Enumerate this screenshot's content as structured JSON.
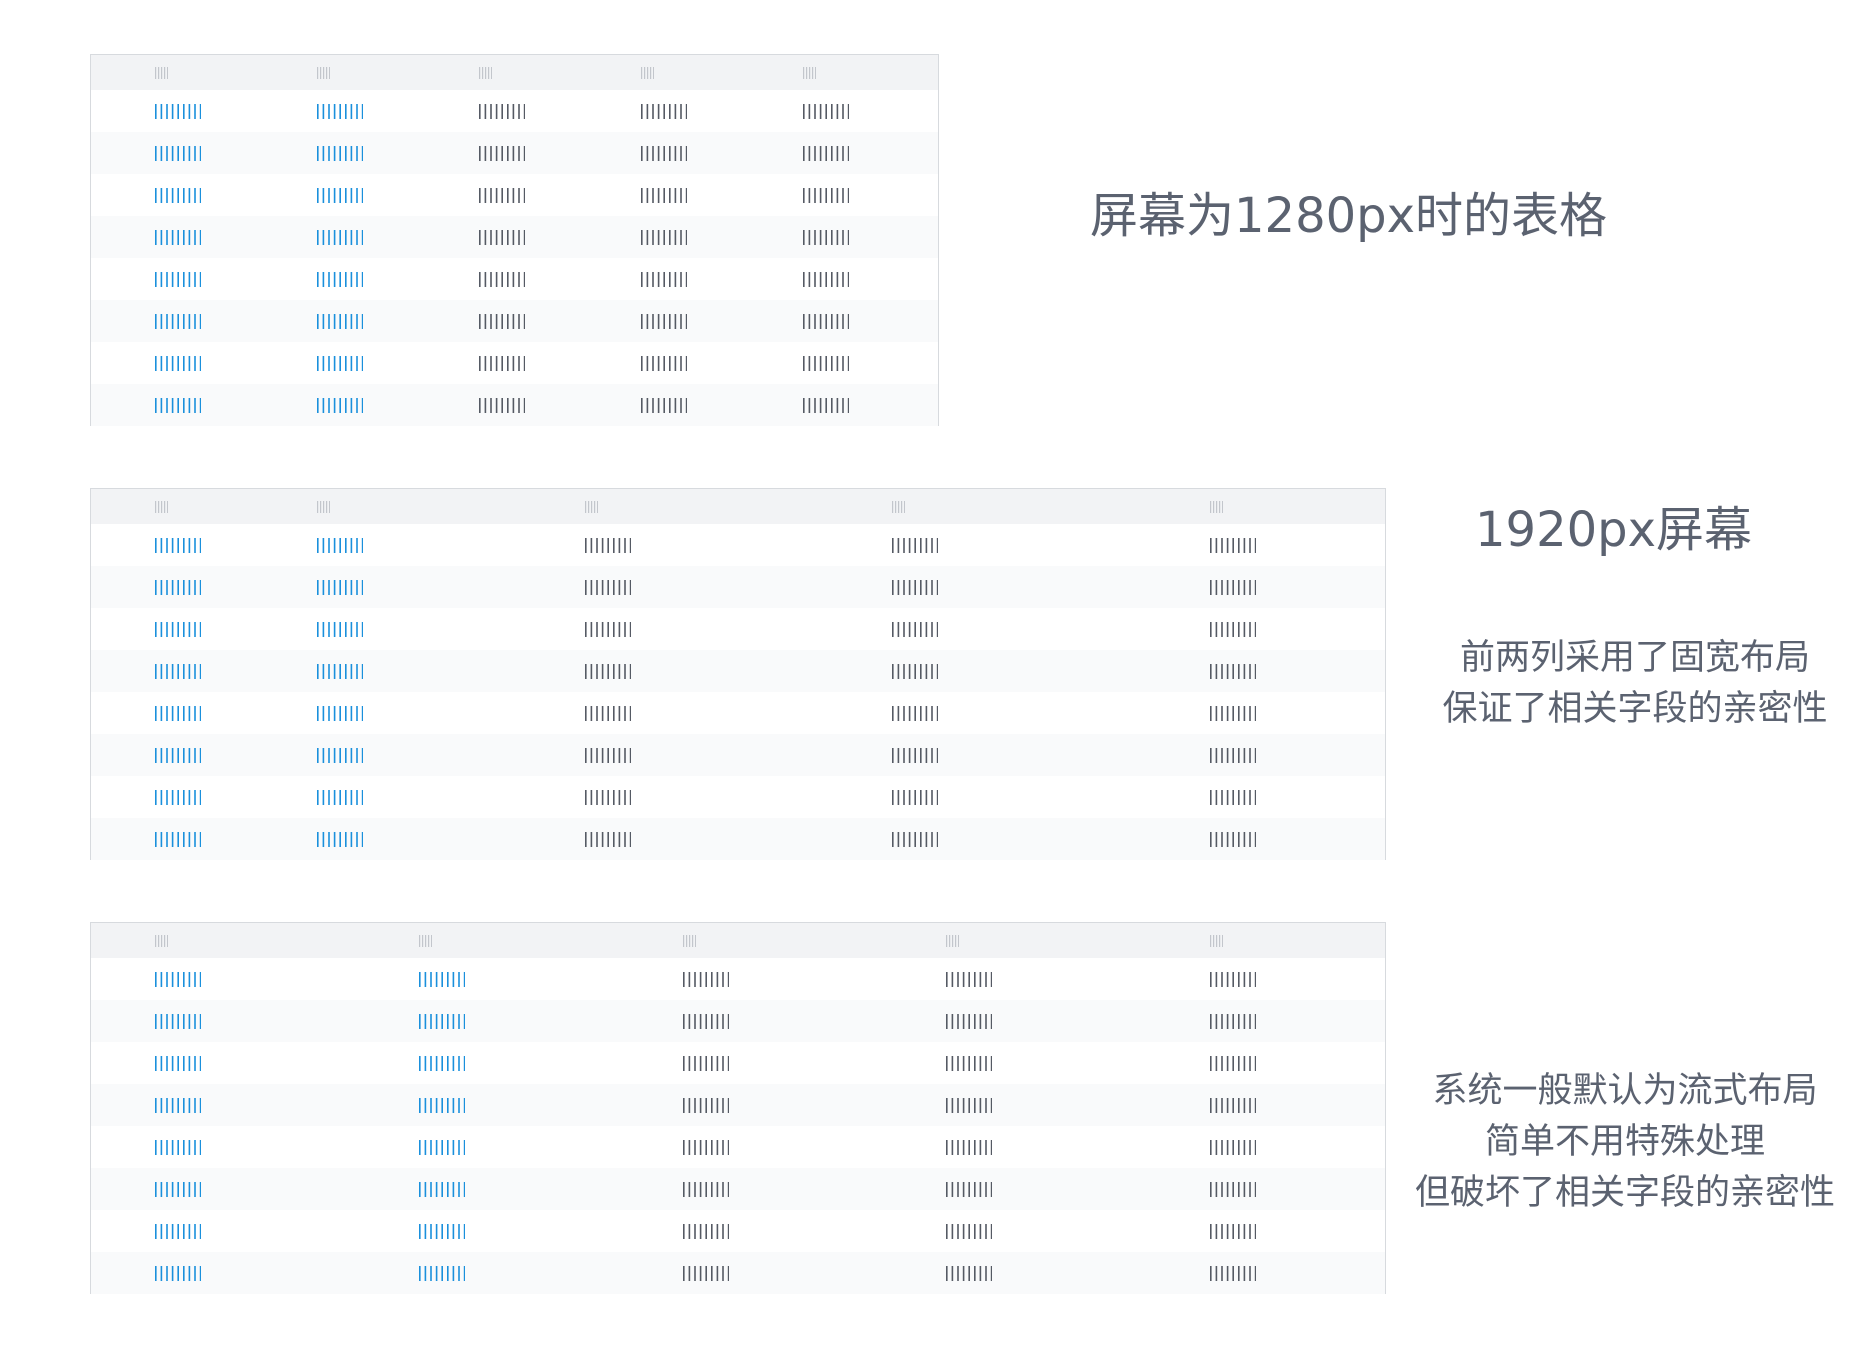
{
  "colors": {
    "link": "#1a90dc",
    "text": "#555a64",
    "header_marks": "#c3c6cc",
    "caption": "#5b6270"
  },
  "header_placeholder_count": 5,
  "cell_placeholder_count": 9,
  "tables": [
    {
      "name": "table-1280",
      "columns": 5,
      "rows": 8,
      "link_columns": 2,
      "caption_lines": [
        "屏幕为1280px时的表格"
      ]
    },
    {
      "name": "table-1920-fixed",
      "columns": 5,
      "rows": 8,
      "link_columns": 2,
      "caption_lines": [
        "1920px屏幕"
      ],
      "note_lines": [
        "前两列采用了固宽布局",
        "保证了相关字段的亲密性"
      ]
    },
    {
      "name": "table-1920-fluid",
      "columns": 5,
      "rows": 8,
      "link_columns": 2,
      "note_lines": [
        "系统一般默认为流式布局",
        "简单不用特殊处理",
        "但破坏了相关字段的亲密性"
      ]
    }
  ]
}
